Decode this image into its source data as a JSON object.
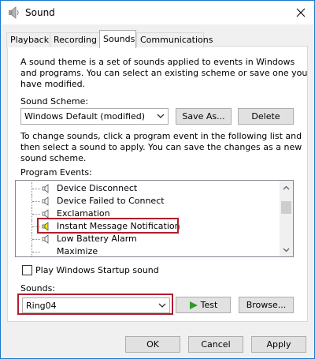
{
  "window": {
    "title": "Sound"
  },
  "tabs": [
    "Playback",
    "Recording",
    "Sounds",
    "Communications"
  ],
  "sounds_tab": {
    "intro_line1": "A sound theme is a set of sounds applied to events in Windows",
    "intro_line2": "and programs.  You can select an existing scheme or save one you",
    "intro_line3": "have modified.",
    "scheme_label": "Sound Scheme:",
    "scheme_value": "Windows Default (modified)",
    "save_as_label": "Save As...",
    "delete_label": "Delete",
    "change_line1": "To change sounds, click a program event in the following list and",
    "change_line2": "then select a sound to apply.  You can save the changes as a new",
    "change_line3": "sound scheme.",
    "program_events_label": "Program Events:",
    "events": [
      "Device Disconnect",
      "Device Failed to Connect",
      "Exclamation",
      "Instant Message Notification",
      "Low Battery Alarm",
      "Maximize"
    ],
    "startup_checkbox_label": "Play Windows Startup sound",
    "startup_checked": false,
    "sounds_label": "Sounds:",
    "sound_value": "Ring04",
    "test_label": "Test",
    "browse_label": "Browse..."
  },
  "footer": {
    "ok_label": "OK",
    "cancel_label": "Cancel",
    "apply_label": "Apply"
  },
  "colors": {
    "highlight": "#b01e2c",
    "accent": "#1979ca"
  }
}
